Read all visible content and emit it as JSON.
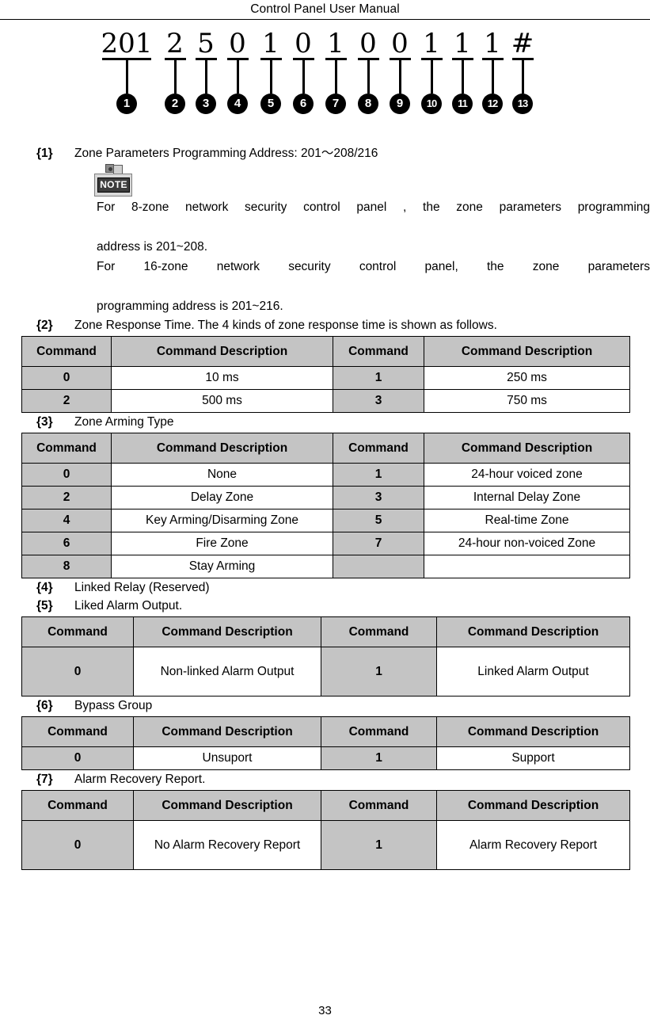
{
  "header": {
    "title": "Control Panel User Manual"
  },
  "diagram": {
    "segments": [
      {
        "digits": "201",
        "marker": "1"
      },
      {
        "digits": "2",
        "marker": "2"
      },
      {
        "digits": "5",
        "marker": "3"
      },
      {
        "digits": "0",
        "marker": "4"
      },
      {
        "digits": "1",
        "marker": "5"
      },
      {
        "digits": "0",
        "marker": "6"
      },
      {
        "digits": "1",
        "marker": "7"
      },
      {
        "digits": "0",
        "marker": "8"
      },
      {
        "digits": "0",
        "marker": "9"
      },
      {
        "digits": "1",
        "marker": "10"
      },
      {
        "digits": "1",
        "marker": "11"
      },
      {
        "digits": "1",
        "marker": "12"
      },
      {
        "digits": "#",
        "marker": "13"
      }
    ]
  },
  "items": {
    "item1": {
      "key": "{1}",
      "text": "Zone Parameters Programming Address: 201～208/216"
    },
    "item2": {
      "key": "{2}",
      "text": "Zone Response Time. The 4 kinds of zone response time is shown as follows."
    },
    "item3": {
      "key": "{3}",
      "text": "Zone Arming Type"
    },
    "item4": {
      "key": "{4}",
      "text": "Linked Relay (Reserved)"
    },
    "item5": {
      "key": "{5}",
      "text": "Liked Alarm Output."
    },
    "item6": {
      "key": "{6}",
      "text": "Bypass Group"
    },
    "item7": {
      "key": "{7}",
      "text": "Alarm Recovery Report."
    }
  },
  "note": {
    "icon_label": "NOTE",
    "line1": "For 8-zone network security control panel , the zone parameters programming",
    "line2": "address is 201~208.",
    "line3": "For 16-zone network security control panel, the zone parameters",
    "line4": "programming address is 201~216."
  },
  "tables": {
    "response_time": {
      "headers": [
        "Command",
        "Command Description",
        "Command",
        "Command Description"
      ],
      "rows": [
        [
          "0",
          "10 ms",
          "1",
          "250 ms"
        ],
        [
          "2",
          "500 ms",
          "3",
          "750 ms"
        ]
      ]
    },
    "arming_type": {
      "headers": [
        "Command",
        "Command Description",
        "Command",
        "Command Description"
      ],
      "rows": [
        [
          "0",
          "None",
          "1",
          "24-hour voiced zone"
        ],
        [
          "2",
          "Delay Zone",
          "3",
          "Internal Delay Zone"
        ],
        [
          "4",
          "Key Arming/Disarming Zone",
          "5",
          "Real-time Zone"
        ],
        [
          "6",
          "Fire Zone",
          "7",
          "24-hour non-voiced Zone"
        ],
        [
          "8",
          "Stay Arming",
          "",
          ""
        ]
      ]
    },
    "alarm_output": {
      "headers": [
        "Command",
        "Command Description",
        "Command",
        "Command Description"
      ],
      "rows": [
        [
          "0",
          "Non-linked Alarm Output",
          "1",
          "Linked Alarm Output"
        ]
      ]
    },
    "bypass_group": {
      "headers": [
        "Command",
        "Command Description",
        "Command",
        "Command Description"
      ],
      "rows": [
        [
          "0",
          "Unsuport",
          "1",
          "Support"
        ]
      ]
    },
    "alarm_recovery": {
      "headers": [
        "Command",
        "Command Description",
        "Command",
        "Command Description"
      ],
      "rows": [
        [
          "0",
          "No Alarm Recovery Report",
          "1",
          "Alarm Recovery Report"
        ]
      ]
    }
  },
  "footer": {
    "page_number": "33"
  },
  "colors": {
    "header_fill": "#c4c4c4",
    "border": "#000000",
    "text": "#000000"
  }
}
